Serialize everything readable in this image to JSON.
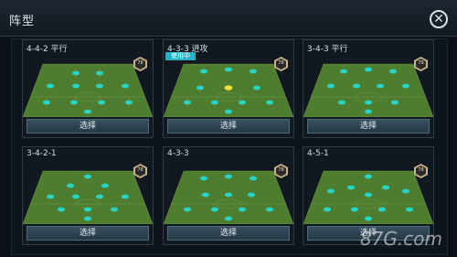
{
  "header": {
    "title": "阵型"
  },
  "cards": [
    {
      "name": "4-4-2 平行",
      "in_use": false,
      "button": "选择",
      "badge": "78"
    },
    {
      "name": "4-3-3 进攻",
      "in_use": true,
      "in_use_label": "使用中",
      "button": "选择",
      "badge": "78"
    },
    {
      "name": "3-4-3 平行",
      "in_use": false,
      "button": "选择",
      "badge": "78"
    },
    {
      "name": "3-4-2-1",
      "in_use": false,
      "button": "选择",
      "badge": "78"
    },
    {
      "name": "4-3-3",
      "in_use": false,
      "button": "选择",
      "badge": "78"
    },
    {
      "name": "4-5-1",
      "in_use": false,
      "button": "选择",
      "badge": "78"
    }
  ],
  "watermark": "87G.com",
  "colors": {
    "accent": "#22b3c8",
    "pitch": "#4f7d2f",
    "player": "#27d4c8"
  }
}
